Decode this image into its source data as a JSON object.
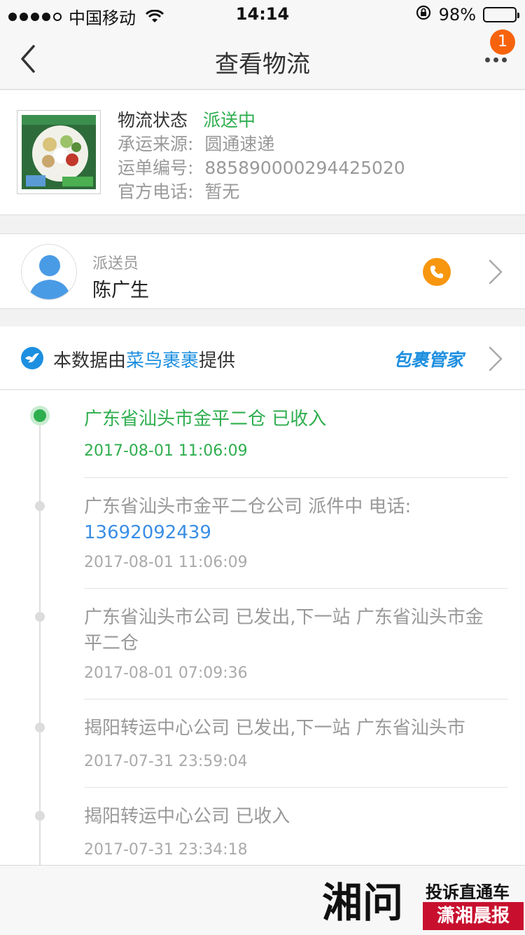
{
  "status_bar": {
    "carrier": "中国移动",
    "time": "14:14",
    "battery": "98%",
    "battery_level": 0.98
  },
  "nav": {
    "title": "查看物流",
    "badge_count": "1"
  },
  "package": {
    "status_label": "物流状态",
    "status_value": "派送中",
    "source_label": "承运来源:",
    "source_value": "圆通速递",
    "tracking_label": "运单编号:",
    "tracking_value": "885890000294425020",
    "phone_label": "官方电话:",
    "phone_value": "暂无"
  },
  "courier": {
    "role": "派送员",
    "name": "陈广生"
  },
  "provider": {
    "prefix": "本数据由",
    "name": "菜鸟裹裹",
    "suffix": "提供",
    "brand": "包裹管家"
  },
  "timeline": [
    {
      "text": "广东省汕头市金平二仓 已收入",
      "phone": "",
      "time": "2017-08-01 11:06:09",
      "active": true
    },
    {
      "text": "广东省汕头市金平二仓公司 派件中 电话:",
      "phone": "13692092439",
      "time": "2017-08-01 11:06:09",
      "active": false
    },
    {
      "text": "广东省汕头市公司 已发出,下一站 广东省汕头市金平二仓",
      "phone": "",
      "time": "2017-08-01 07:09:36",
      "active": false
    },
    {
      "text": "揭阳转运中心公司 已发出,下一站 广东省汕头市",
      "phone": "",
      "time": "2017-07-31 23:59:04",
      "active": false
    },
    {
      "text": "揭阳转运中心公司 已收入",
      "phone": "",
      "time": "2017-07-31 23:34:18",
      "active": false
    }
  ],
  "watermark": {
    "big": "湘问",
    "line1": "投诉直通车",
    "line2": "潇湘晨报"
  },
  "colors": {
    "accent_green": "#2fae4e",
    "link_blue": "#1d8fe0",
    "badge_orange": "#f7630c",
    "call_orange": "#f7960f"
  }
}
